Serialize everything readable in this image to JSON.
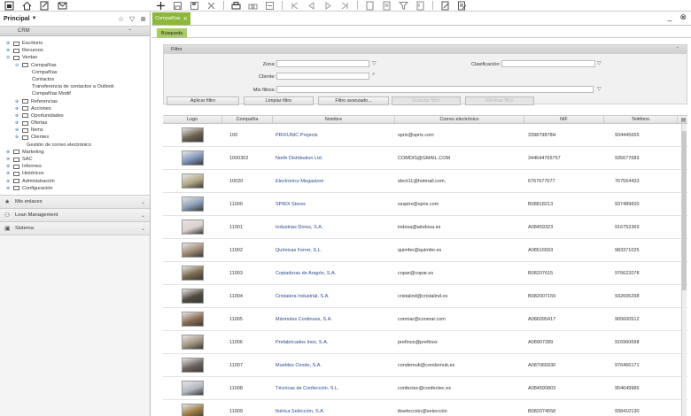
{
  "sidebar": {
    "title": "Principal",
    "panel": "CRM",
    "tree": [
      {
        "label": "Escritorio",
        "level": 0,
        "exp": "+"
      },
      {
        "label": "Recursos",
        "level": 0,
        "exp": "+"
      },
      {
        "label": "Ventas",
        "level": 0,
        "exp": "-"
      },
      {
        "label": "Compañías",
        "level": 1,
        "exp": "-"
      },
      {
        "label": "Compañías",
        "level": 2,
        "exp": ""
      },
      {
        "label": "Contactos",
        "level": 2,
        "exp": ""
      },
      {
        "label": "Transferencia de contactos a Outlook",
        "level": 2,
        "exp": ""
      },
      {
        "label": "Compañías Modif",
        "level": 2,
        "exp": ""
      },
      {
        "label": "Referencias",
        "level": 1,
        "exp": "+"
      },
      {
        "label": "Acciones",
        "level": 1,
        "exp": "+"
      },
      {
        "label": "Oportunidades",
        "level": 1,
        "exp": "+"
      },
      {
        "label": "Ofertas",
        "level": 1,
        "exp": "+"
      },
      {
        "label": "Ítems",
        "level": 1,
        "exp": "+"
      },
      {
        "label": "Clientes",
        "level": 1,
        "exp": "+"
      },
      {
        "label": "Gestión de correo electrónico",
        "level": 1,
        "exp": ""
      },
      {
        "label": "Marketing",
        "level": 0,
        "exp": "+"
      },
      {
        "label": "SAC",
        "level": 0,
        "exp": "+"
      },
      {
        "label": "Informes",
        "level": 0,
        "exp": "+"
      },
      {
        "label": "Históricos",
        "level": 0,
        "exp": "+"
      },
      {
        "label": "Administración",
        "level": 0,
        "exp": "+"
      },
      {
        "label": "Configuración",
        "level": 0,
        "exp": "+"
      }
    ],
    "accordions": [
      "Mis enlaces",
      "Lean Management",
      "Sistema"
    ]
  },
  "tabs": {
    "active": "Compañías",
    "subtab": "Búsqueda"
  },
  "filter": {
    "title": "Filtro",
    "zona_label": "Zona:",
    "cliente_label": "Cliente:",
    "misfiltros_label": "Mis filtros:",
    "clasificacion_label": "Clasificación:",
    "zona_value": "",
    "cliente_value": "",
    "misfiltros_value": "",
    "clasificacion_value": "",
    "buttons": [
      "Aplicar filtro",
      "Limpiar filtro",
      "Filtro avanzado...",
      "Guardar filtro",
      "Eliminar filtro"
    ]
  },
  "grid": {
    "headers": [
      "Logo",
      "Compañía",
      "Nombre",
      "Correo electrónico",
      "NIF",
      "Teléfono"
    ],
    "rows": [
      {
        "comp": "100",
        "name": "PRIXUNIC Projects",
        "mail": "sprix@sprix.com",
        "nif": "339879878H",
        "tel": "934445655",
        "logo": "#6e6250"
      },
      {
        "comp": "1000302",
        "name": "North Distribution Ltd.",
        "mail": "COMDIS@GMAIL.COM",
        "nif": "344644765757",
        "tel": "935677689",
        "logo": "#7c93b8"
      },
      {
        "comp": "10020",
        "name": "Electronics Megastore",
        "mail": "elect11@hotmail.com,",
        "nif": "6767677677",
        "tel": "767554433",
        "logo": "#b1a886"
      },
      {
        "comp": "11000",
        "name": "SPRIX Stores",
        "mail": "sssprix@sprix.com",
        "nif": "B08818213",
        "tel": "937489600",
        "logo": "#8a9db5"
      },
      {
        "comp": "11001",
        "name": "Industrias Dores, S.A.",
        "mail": "indosa@aindosa.es",
        "nif": "A08459323",
        "tel": "916752369",
        "logo": "#d8d0cc"
      },
      {
        "comp": "11002",
        "name": "Químicas Ferrer, S.L.",
        "mail": "quimfer@quimfer.es",
        "nif": "A08516593",
        "tel": "983371025",
        "logo": "#9e8a74"
      },
      {
        "comp": "11003",
        "name": "Copiadoras de Aragón, S.A.",
        "mail": "copar@copar.es",
        "nif": "B08207615",
        "tel": "976622078",
        "logo": "#7a6a4c"
      },
      {
        "comp": "11004",
        "name": "Cristalera Industrial, S.A.",
        "mail": "cristalind@cristalind.es",
        "nif": "B082007159",
        "tel": "932606298",
        "logo": "#4f4a3e"
      },
      {
        "comp": "11005",
        "name": "Mármoles Continuos, S.A.",
        "mail": "conmar@conmar.com",
        "nif": "A086095417",
        "tel": "965600512",
        "logo": "#8c6c52"
      },
      {
        "comp": "11006",
        "name": "Prefabricados Inox, S.A.",
        "mail": "prefinox@prefinox",
        "nif": "A08907289",
        "tel": "916960698",
        "logo": "#a09480"
      },
      {
        "comp": "11007",
        "name": "Muebles Conde, S.A.",
        "mail": "condemub@condemub.es",
        "nif": "A087065930",
        "tel": "976466171",
        "logo": "#6a6460"
      },
      {
        "comp": "11008",
        "name": "Técnicas de Confección, S.L.",
        "mail": "confectec@confectec.es",
        "nif": "A084590803",
        "tel": "954649986",
        "logo": "#b4b8c0"
      },
      {
        "comp": "11009",
        "name": "Ibérica Selección, S.A.",
        "mail": "ibselección@selección",
        "nif": "B082074558",
        "tel": "938410130",
        "logo": "#9a7840"
      }
    ]
  },
  "colors": {
    "tab_green": "#8bb73a",
    "subtab_green": "#a9cd5f",
    "link_blue": "#2c4a8a"
  }
}
